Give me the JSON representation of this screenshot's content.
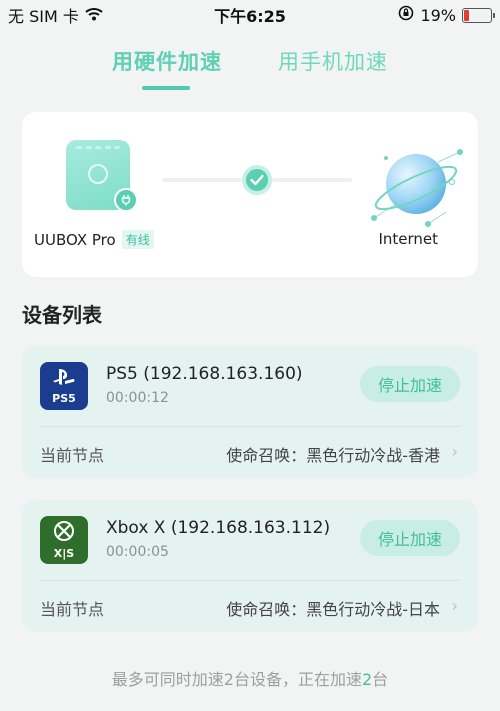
{
  "status_bar": {
    "carrier": "无 SIM 卡",
    "wifi_icon": "wifi-icon",
    "time": "下午6:25",
    "lock_icon": "orientation-lock-icon",
    "battery_percent": "19%",
    "battery_level": 0.19
  },
  "tabs": [
    {
      "label": "用硬件加速",
      "active": true
    },
    {
      "label": "用手机加速",
      "active": false
    }
  ],
  "connection": {
    "device_name": "UUBOX Pro",
    "device_tag": "有线",
    "destination": "Internet",
    "status_icon": "check-icon"
  },
  "device_list": {
    "title": "设备列表",
    "items": [
      {
        "icon": "ps5-icon",
        "icon_text": "PS5",
        "name": "PS5 (192.168.163.160)",
        "elapsed": "00:00:12",
        "button": "停止加速",
        "node_label": "当前节点",
        "node_value": "使命召唤：黑色行动冷战-香港"
      },
      {
        "icon": "xbox-icon",
        "icon_text": "X|S",
        "name": "Xbox X (192.168.163.112)",
        "elapsed": "00:00:05",
        "button": "停止加速",
        "node_label": "当前节点",
        "node_value": "使命召唤：黑色行动冷战-日本"
      }
    ]
  },
  "footer": {
    "text_before": "最多可同时加速2台设备，正在加速",
    "count": "2",
    "text_after": "台"
  },
  "colors": {
    "accent": "#52c9ad",
    "card_bg": "#e4f3ef",
    "ps_blue": "#1a3d8f",
    "xbox_green": "#2f6e2a"
  }
}
